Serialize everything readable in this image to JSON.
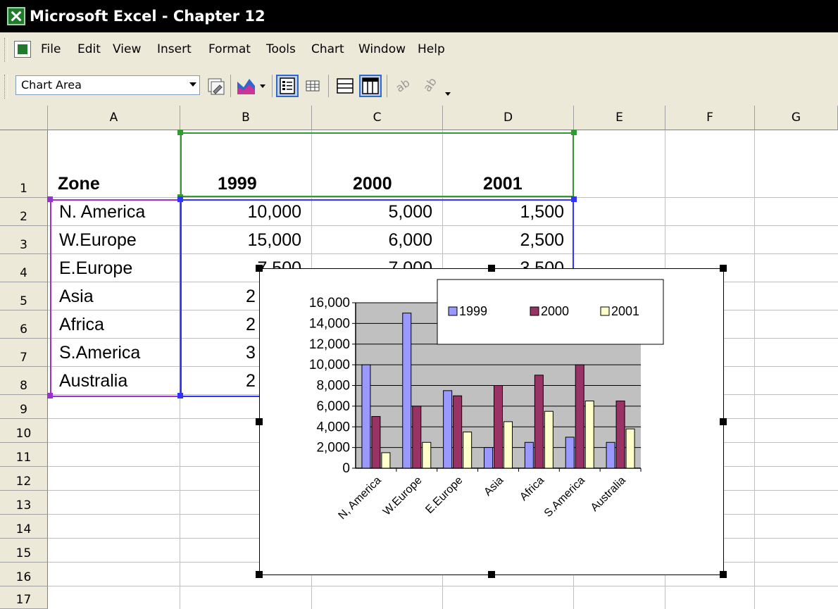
{
  "window": {
    "title": "Microsoft Excel - Chapter 12"
  },
  "menu": {
    "items": [
      "File",
      "Edit",
      "View",
      "Insert",
      "Format",
      "Tools",
      "Chart",
      "Window",
      "Help"
    ]
  },
  "toolbar": {
    "namebox_value": "Chart Area",
    "buttons": [
      "chart-properties-icon",
      "chart-type-icon",
      "legend-icon",
      "data-table-icon",
      "by-row-icon",
      "by-column-icon",
      "angle-clockwise-icon",
      "angle-counterclockwise-icon"
    ]
  },
  "grid": {
    "columns": [
      "A",
      "B",
      "C",
      "D",
      "E",
      "F",
      "G"
    ],
    "rows": [
      "1",
      "2",
      "3",
      "4",
      "5",
      "6",
      "7",
      "8",
      "9",
      "10",
      "11",
      "12",
      "13",
      "14",
      "15",
      "16",
      "17"
    ],
    "header": {
      "zone": "Zone",
      "y1999": "1999",
      "y2000": "2000",
      "y2001": "2001"
    },
    "zones": [
      "N. America",
      "W.Europe",
      "E.Europe",
      "Asia",
      "Africa",
      "S.America",
      "Australia"
    ],
    "values_b": [
      "10,000",
      "15,000",
      "7,500",
      "2",
      "2",
      "3",
      "2"
    ],
    "values_c": [
      "5,000",
      "6,000",
      "7,000"
    ],
    "values_d": [
      "1,500",
      "2,500",
      "3,500"
    ]
  },
  "chart_data": {
    "type": "bar",
    "categories": [
      "N, America",
      "W.Europe",
      "E.Europe",
      "Asia",
      "Africa",
      "S.America",
      "Australia"
    ],
    "series": [
      {
        "name": "1999",
        "values": [
          10000,
          15000,
          7500,
          2000,
          2500,
          3000,
          2500
        ],
        "color": "#9999ff"
      },
      {
        "name": "2000",
        "values": [
          5000,
          6000,
          7000,
          8000,
          9000,
          10000,
          6500
        ],
        "color": "#993366"
      },
      {
        "name": "2001",
        "values": [
          1500,
          2500,
          3500,
          4500,
          5500,
          6500,
          3800
        ],
        "color": "#ffffcc"
      }
    ],
    "y_ticks": [
      "0",
      "2,000",
      "4,000",
      "6,000",
      "8,000",
      "10,000",
      "12,000",
      "14,000",
      "16,000"
    ],
    "ylim": [
      0,
      16000
    ],
    "plot_background": "#c0c0c0",
    "grid": true,
    "legend_position": "top-right"
  }
}
